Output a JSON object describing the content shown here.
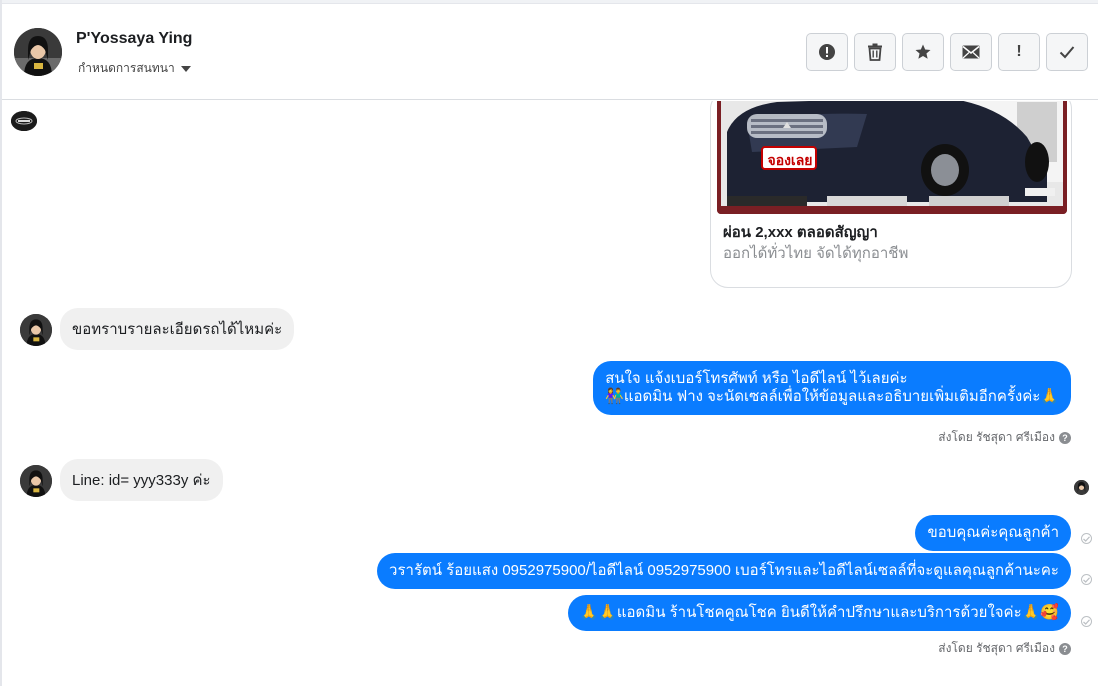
{
  "header": {
    "contact_name": "P'Yossaya Ying",
    "assign_label": "กำหนดการสนทนา"
  },
  "card": {
    "title": "ผ่อน 2,xxx ตลอดสัญญา",
    "subtitle": "ออกได้ทั่วไทย จัดได้ทุกอาชีพ",
    "image_sign": "จองเลย"
  },
  "messages": [
    {
      "dir": "in",
      "text": "ขอทราบรายละเอียดรถได้ไหมค่ะ"
    },
    {
      "dir": "out",
      "lines": [
        "สนใจ แจ้งเบอร์โทรศัพท์ หรือ ไอดีไลน์  ไว้เลยค่ะ",
        "👫แอดมิน ฟาง จะนัดเซลล์เพื่อให้ข้อมูลและอธิบายเพิ่มเติมอีกครั้งค่ะ🙏"
      ],
      "sent_by": "ส่งโดย รัชสุดา ศรีเมือง"
    },
    {
      "dir": "in",
      "text": "Line: id= yyy333y  ค่ะ"
    },
    {
      "dir": "out",
      "text": "ขอบคุณค่ะคุณลูกค้า"
    },
    {
      "dir": "out",
      "text": "วรารัตน์ ร้อยแสง     0952975900/ไอดีไลน์ 0952975900   เบอร์โทรและไอดีไลน์เซลล์ที่จะดูแลคุณลูกค้านะคะ"
    },
    {
      "dir": "out",
      "text": "🙏🙏แอดมิน ร้านโชคคูณโชค ยินดีให้คำปรึกษาและบริการด้วยใจค่ะ🙏🥰",
      "sent_by": "ส่งโดย รัชสุดา ศรีเมือง"
    }
  ],
  "colors": {
    "outgoing_bubble": "#0a7cff",
    "incoming_bubble": "#f0f0f0"
  }
}
